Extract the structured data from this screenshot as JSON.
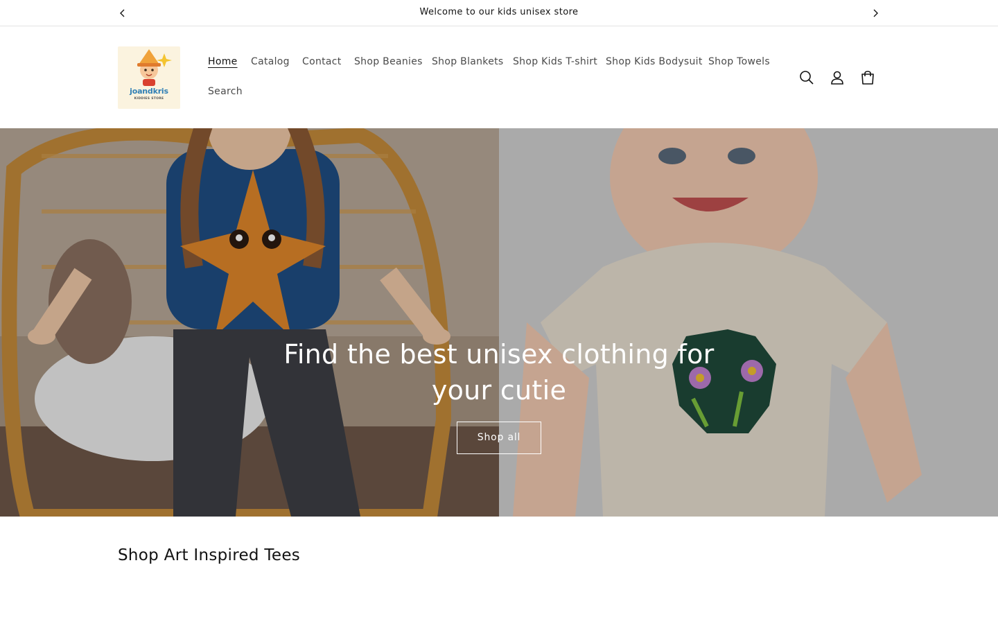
{
  "announcement": {
    "text": "Welcome to our kids unisex store",
    "prev_icon": "chevron-left-icon",
    "next_icon": "chevron-right-icon"
  },
  "header": {
    "logo": {
      "brand": "joandkris",
      "tagline": "KIDDIES STORE"
    },
    "nav": [
      {
        "label": "Home",
        "active": true
      },
      {
        "label": "Catalog",
        "active": false
      },
      {
        "label": "Contact",
        "active": false
      },
      {
        "label": "Shop Beanies",
        "active": false
      },
      {
        "label": "Shop Blankets",
        "active": false
      },
      {
        "label": "Shop Kids T-shirt",
        "active": false
      },
      {
        "label": "Shop Kids Bodysuit",
        "active": false
      },
      {
        "label": "Shop Towels",
        "active": false
      },
      {
        "label": "Search",
        "active": false
      }
    ],
    "icons": [
      "search-icon",
      "account-icon",
      "cart-icon"
    ]
  },
  "hero": {
    "heading": "Find the best unisex clothing for your cutie",
    "button_label": "Shop all"
  },
  "section": {
    "title": "Shop Art Inspired Tees"
  },
  "colors": {
    "text": "#121212",
    "nav_text": "#4a4a4a",
    "border": "#e4e4e4",
    "hero_text": "#ffffff"
  }
}
